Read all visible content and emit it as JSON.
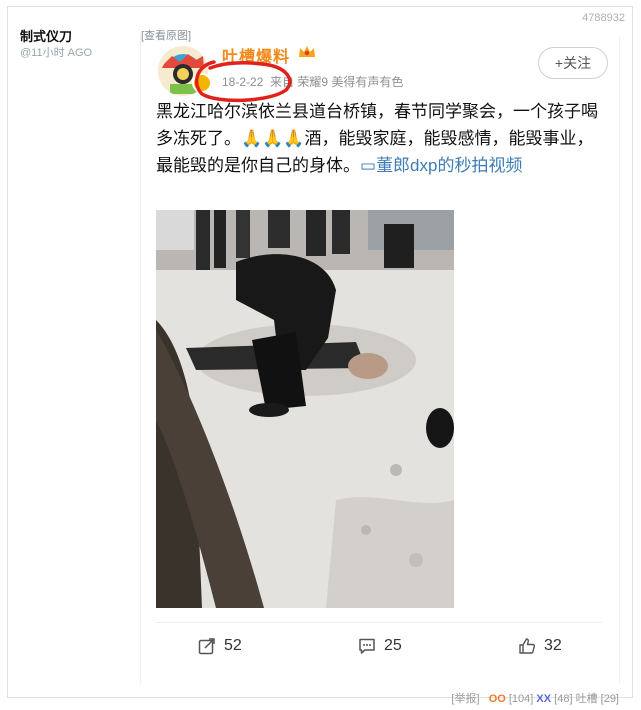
{
  "poster": {
    "name": "制式仪刀",
    "time": "@11小时 AGO"
  },
  "post_id": "4788932",
  "view_original": "[查看原图]",
  "author": {
    "name": "吐槽爆料",
    "date": "18-2-22",
    "source": "来自 荣耀9 美得有声有色"
  },
  "follow_label": "+关注",
  "content": {
    "text": "黑龙江哈尔滨依兰县道台桥镇，春节同学聚会，一个孩子喝多冻死了。🙏🙏🙏酒，能毁家庭，能毁感情，能毁事业，最能毁的是你自己的身体。",
    "link_icon": "▭",
    "link": "董郎dxp的秒拍视频"
  },
  "actions": {
    "share": "52",
    "comment": "25",
    "like": "32"
  },
  "footer": {
    "report": "[举报]",
    "oo": "OO",
    "oo_count": "[104]",
    "xx": "XX",
    "xx_count": "[48]",
    "tag": "吐槽",
    "tag_count": "[29]"
  },
  "colors": {
    "author": "#f08a1c",
    "link": "#3e7cb6",
    "annotation": "#e0211c"
  },
  "icons": [
    "share-icon",
    "comment-icon",
    "like-icon",
    "crown-icon"
  ]
}
